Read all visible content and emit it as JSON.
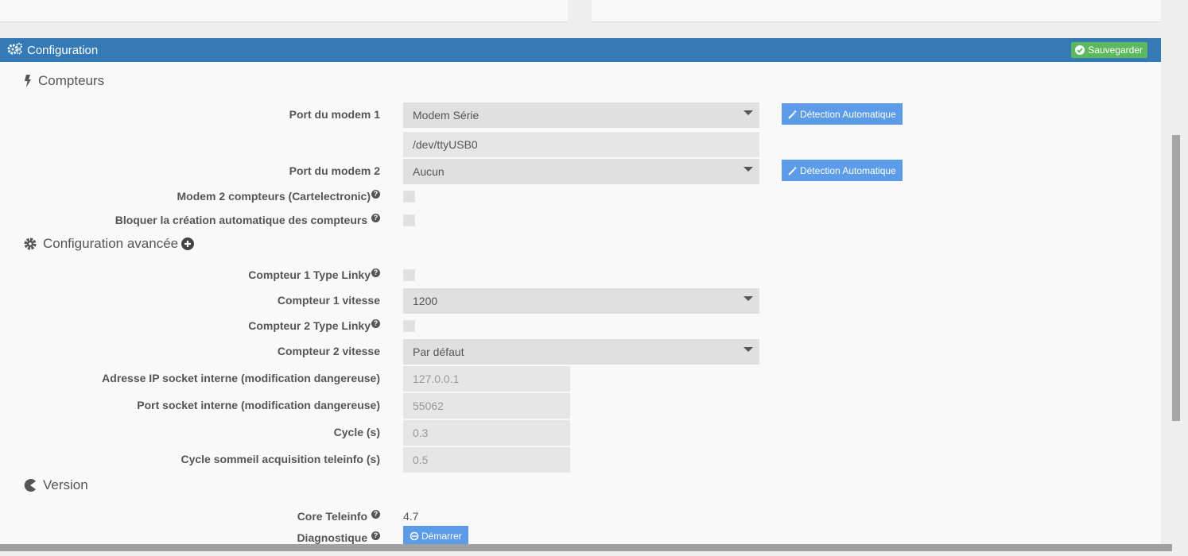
{
  "header": {
    "title": "Configuration",
    "save_label": "Sauvegarder"
  },
  "sections": {
    "compteurs": "Compteurs",
    "advanced": "Configuration avancée",
    "version": "Version"
  },
  "fields": {
    "modem1": {
      "label": "Port du modem 1",
      "value": "Modem Série",
      "detect": "Détection Automatique"
    },
    "modem1_path": {
      "value": "/dev/ttyUSB0"
    },
    "modem2": {
      "label": "Port du modem 2",
      "value": "Aucun",
      "detect": "Détection Automatique"
    },
    "modem2_compteurs": {
      "label": "Modem 2 compteurs (Cartelectronic)"
    },
    "bloquer": {
      "label": "Bloquer la création automatique des compteurs"
    },
    "c1_linky": {
      "label": "Compteur 1 Type Linky"
    },
    "c1_vitesse": {
      "label": "Compteur 1 vitesse",
      "value": "1200"
    },
    "c2_linky": {
      "label": "Compteur 2 Type Linky"
    },
    "c2_vitesse": {
      "label": "Compteur 2 vitesse",
      "value": "Par défaut"
    },
    "ip_socket": {
      "label": "Adresse IP socket interne (modification dangereuse)",
      "value": "127.0.0.1"
    },
    "port_socket": {
      "label": "Port socket interne (modification dangereuse)",
      "value": "55062"
    },
    "cycle": {
      "label": "Cycle (s)",
      "value": "0.3"
    },
    "cycle_sommeil": {
      "label": "Cycle sommeil acquisition teleinfo (s)",
      "value": "0.5"
    },
    "core": {
      "label": "Core Teleinfo",
      "value": "4.7"
    },
    "diag": {
      "label": "Diagnostique",
      "button": "Démarrer"
    }
  },
  "icons": {
    "help": "question-circle-icon",
    "accent": "#337ab7",
    "success": "#5cb85c",
    "action": "#5b9be8"
  }
}
